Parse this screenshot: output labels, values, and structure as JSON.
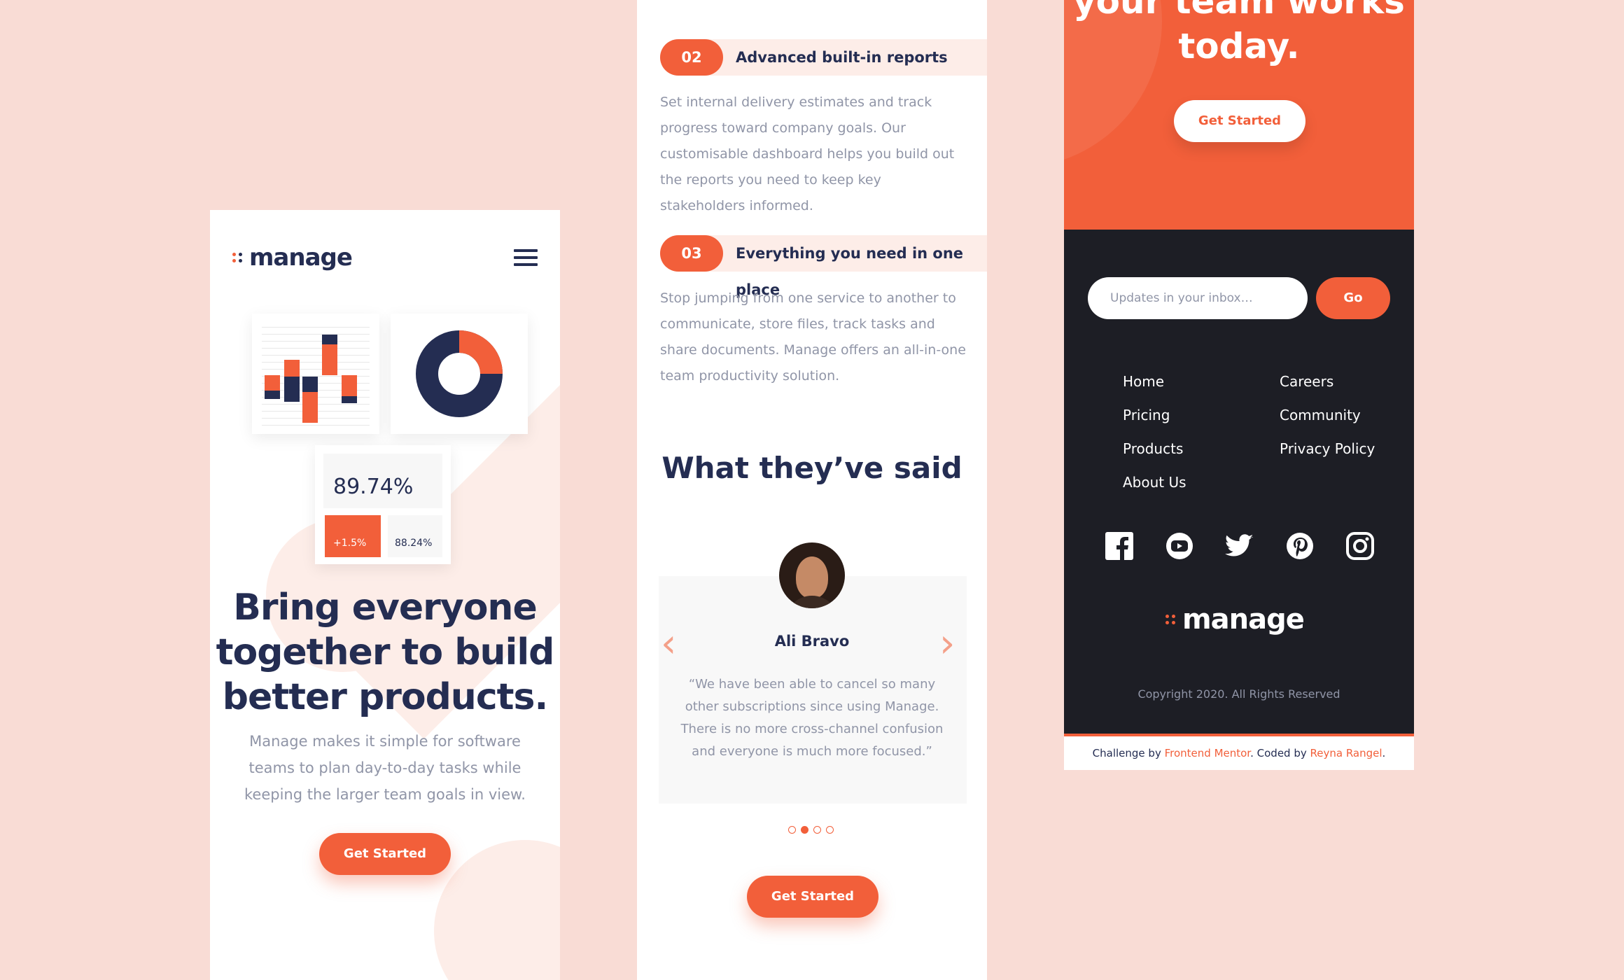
{
  "brand": {
    "name": "manage",
    "accent": "#f25f3a",
    "navy": "#242d52",
    "dark": "#1d1e25",
    "bg": "#f9dcd5"
  },
  "hero": {
    "title": "Bring everyone together to build better products.",
    "description": "Manage makes it simple for software teams to plan day-to-day tasks while keeping the larger team goals in view.",
    "cta": "Get Started",
    "stats": {
      "main": "89.74%",
      "change": "+1.5%",
      "secondary": "88.24%"
    },
    "donut_fraction": 0.25
  },
  "features": [
    {
      "number": "02",
      "title": "Advanced built-in reports",
      "description": "Set internal delivery estimates and track progress toward company goals. Our customisable dashboard helps you build out the reports you need to keep key stakeholders informed."
    },
    {
      "number": "03",
      "title": "Everything you need in one place",
      "description": "Stop jumping from one service to another to communicate, store files, track tasks and share documents. Manage offers an all-in-one team productivity solution."
    }
  ],
  "testimonials": {
    "heading": "What they’ve said",
    "name": "Ali Bravo",
    "quote": "“We have been able to cancel so many other subscriptions since using Manage. There is no more cross-channel confusion and everyone is much more focused.”",
    "prev_icon": "chevron-left-icon",
    "next_icon": "chevron-right-icon",
    "active_dot": 2,
    "dot_count": 4,
    "cta": "Get Started"
  },
  "cta_banner": {
    "title_line1": "your team works",
    "title_line2": "today.",
    "button": "Get Started"
  },
  "footer": {
    "newsletter_placeholder": "Updates in your inbox…",
    "go_label": "Go",
    "links_col1": [
      "Home",
      "Pricing",
      "Products",
      "About Us"
    ],
    "links_col2": [
      "Careers",
      "Community",
      "Privacy Policy"
    ],
    "socials": [
      "facebook-icon",
      "youtube-icon",
      "twitter-icon",
      "pinterest-icon",
      "instagram-icon"
    ],
    "copyright": "Copyright 2020. All Rights Reserved"
  },
  "attribution": {
    "prefix": "Challenge by ",
    "fm": "Frontend Mentor",
    "middle": ". Coded by ",
    "author": "Reyna Rangel",
    "suffix": "."
  }
}
